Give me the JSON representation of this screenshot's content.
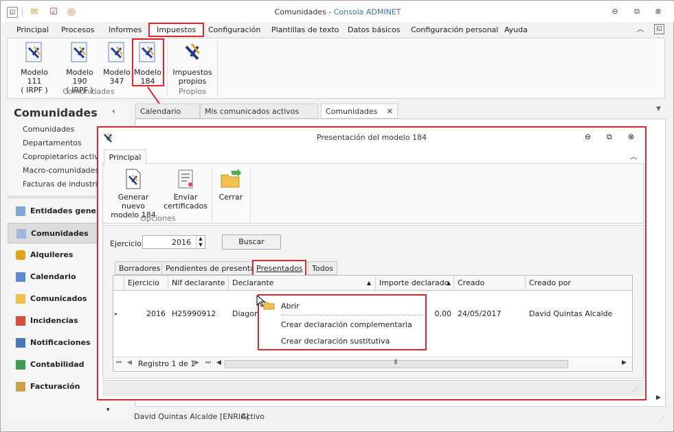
{
  "window": {
    "title_app": "Comunidades - ",
    "title_sub": "Consola ADMINET",
    "minimize": "⊖",
    "restore": "⧉",
    "close": "⊗"
  },
  "menu": {
    "items": [
      "Principal",
      "Procesos",
      "Informes",
      "Impuestos",
      "Configuración",
      "Plantillas de texto",
      "Datos básicos",
      "Configuración personal",
      "Ayuda"
    ]
  },
  "ribbon": {
    "buttons": [
      {
        "line1": "Modelo 111",
        "line2": "( IRPF )"
      },
      {
        "line1": "Modelo 190",
        "line2": "( IRPF )"
      },
      {
        "line1": "Modelo",
        "line2": "347"
      },
      {
        "line1": "Modelo",
        "line2": "184"
      },
      {
        "line1": "Impuestos",
        "line2": "propios"
      }
    ],
    "group1": "Comunidades",
    "group2": "Propios"
  },
  "nav": {
    "title": "Comunidades",
    "links": [
      "Comunidades",
      "Departamentos",
      "Copropietarios activos",
      "Macro-comunidades",
      "Facturas de industriales"
    ],
    "sections": [
      "Entidades genera",
      "Comunidades",
      "Alquileres",
      "Calendario",
      "Comunicados",
      "Incidencias",
      "Notificaciones",
      "Contabilidad",
      "Facturación"
    ]
  },
  "doctabs": [
    "Calendario",
    "Mis comunicados activos",
    "Comunidades"
  ],
  "dialog": {
    "title": "Presentación del modelo 184",
    "tab": "Principal",
    "buttons": [
      {
        "line1": "Generar nuevo",
        "line2": "modelo 184"
      },
      {
        "line1": "Enviar",
        "line2": "certificados"
      },
      {
        "line1": "Cerrar",
        "line2": ""
      }
    ],
    "group": "Opciones",
    "ejercicio_label": "Ejercicio:",
    "ejercicio_value": "2016",
    "buscar": "Buscar",
    "filter_tabs": [
      "Borradores",
      "Pendientes de presentar",
      "Presentados",
      "Todos"
    ],
    "grid": {
      "columns": [
        "Ejercicio",
        "Nif declarante",
        "Declarante",
        "Importe declarado",
        "Creado",
        "Creado por"
      ],
      "row": [
        "2016",
        "H25990912",
        "Diagona",
        "0,00",
        "24/05/2017",
        "David Quintas Alcalde"
      ]
    },
    "pager": "Registro 1 de 1"
  },
  "context_menu": [
    "Abrir",
    "Crear declaración complementaria",
    "Crear declaración sustitutiva"
  ],
  "status": {
    "user": "David Quintas Alcalde [ENRIC]",
    "state": "Activo"
  },
  "colors": {
    "highlight": "#e0262b",
    "accent": "#3b73b9"
  }
}
